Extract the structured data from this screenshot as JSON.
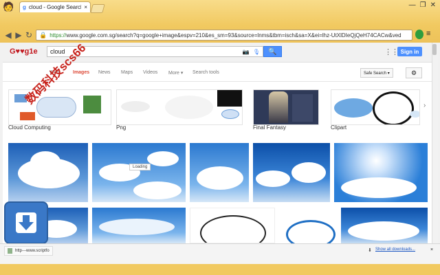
{
  "browser": {
    "tab_title": "cloud - Google Search",
    "url_scheme": "https://",
    "url_rest": "www.google.com.sg/search?q=google+image&espv=210&es_sm=93&source=lnms&tbm=isch&sa=X&ei=lhz-UtXlDIeQjQeH74CACw&ved",
    "back_icon": "back-arrow-icon",
    "forward_icon": "forward-arrow-icon",
    "reload_icon": "reload-icon"
  },
  "google": {
    "logo_text": "G♥♥g1e",
    "search_value": "cloud",
    "signin_label": "Sign in",
    "nav": [
      "Web",
      "Images",
      "News",
      "Maps",
      "Videos",
      "More ▾",
      "Search tools"
    ],
    "safesearch_label": "Safe Search ▾",
    "related": [
      "Cloud Computing",
      "Png",
      "Final Fantasy",
      "Clipart"
    ],
    "loading_label": "Loading"
  },
  "download_bar": {
    "item_label": "http---www.scriptfo",
    "show_all": "Show all downloads...",
    "close": "×"
  },
  "overlay": {
    "watermark_text": "数码科技scs66"
  },
  "colors": {
    "google_blue": "#4d90fe",
    "active_nav": "#dd4b39",
    "chrome_frame": "#f1c960"
  }
}
